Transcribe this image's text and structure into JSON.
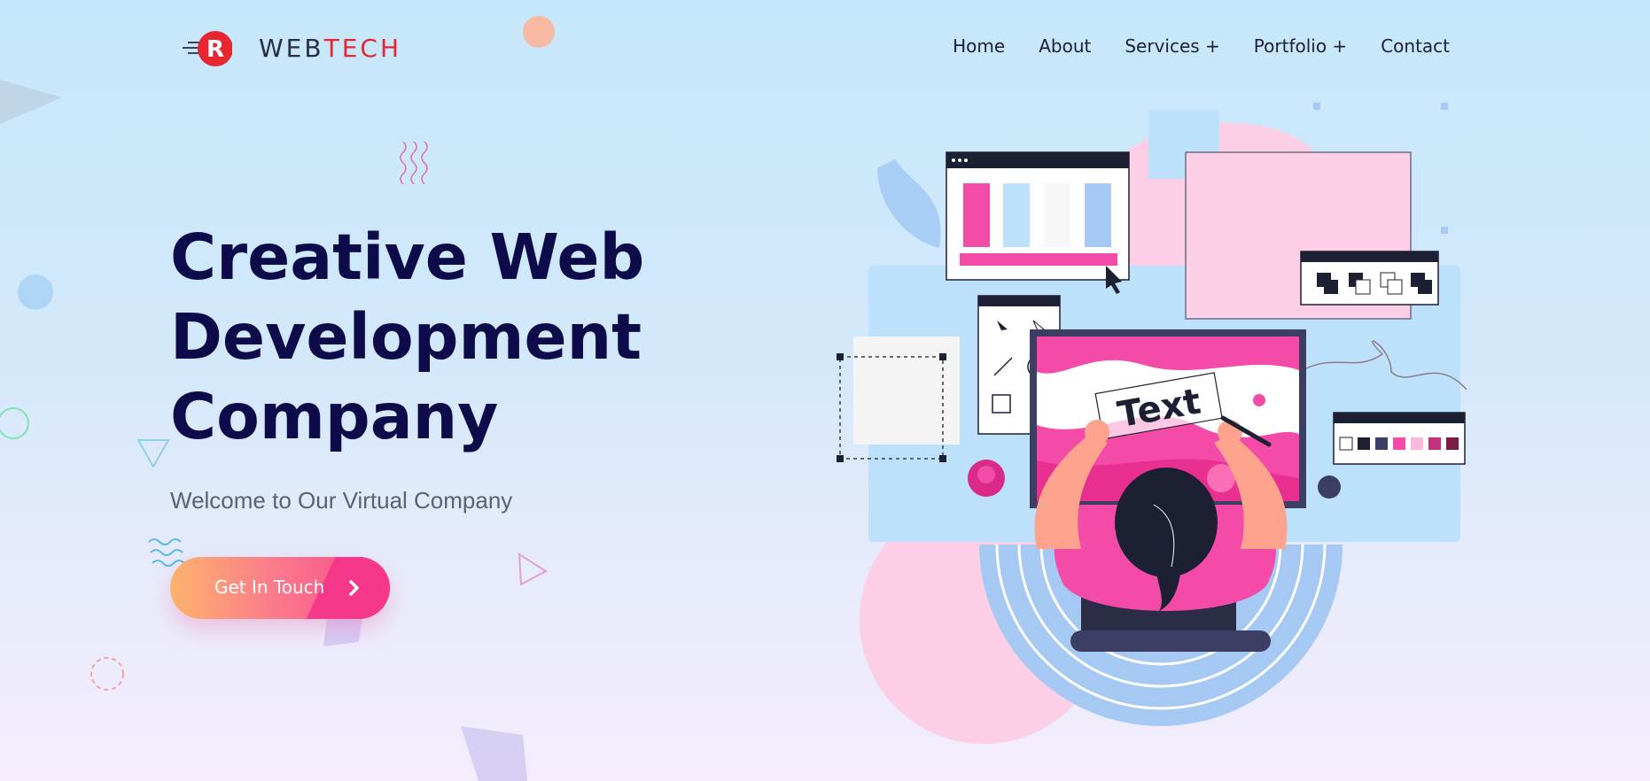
{
  "brand": {
    "name_dark": "WEB",
    "name_red": "TECH",
    "logo_letter": "R"
  },
  "nav": {
    "items": [
      {
        "label": "Home"
      },
      {
        "label": "About"
      },
      {
        "label": "Services +"
      },
      {
        "label": "Portfolio  +"
      },
      {
        "label": "Contact"
      }
    ]
  },
  "hero": {
    "title_lines": [
      "Creative Web",
      "Development",
      "Company"
    ],
    "subtitle": "Welcome to Our Virtual Company",
    "cta_label": "Get In Touch",
    "cta_icon": "chevron-right-icon"
  },
  "illustration": {
    "canvas_text": "Text"
  },
  "colors": {
    "title": "#0e0b4b",
    "accent_pink": "#f9468f",
    "accent_orange": "#fcb36d",
    "brand_red": "#e8262f"
  }
}
